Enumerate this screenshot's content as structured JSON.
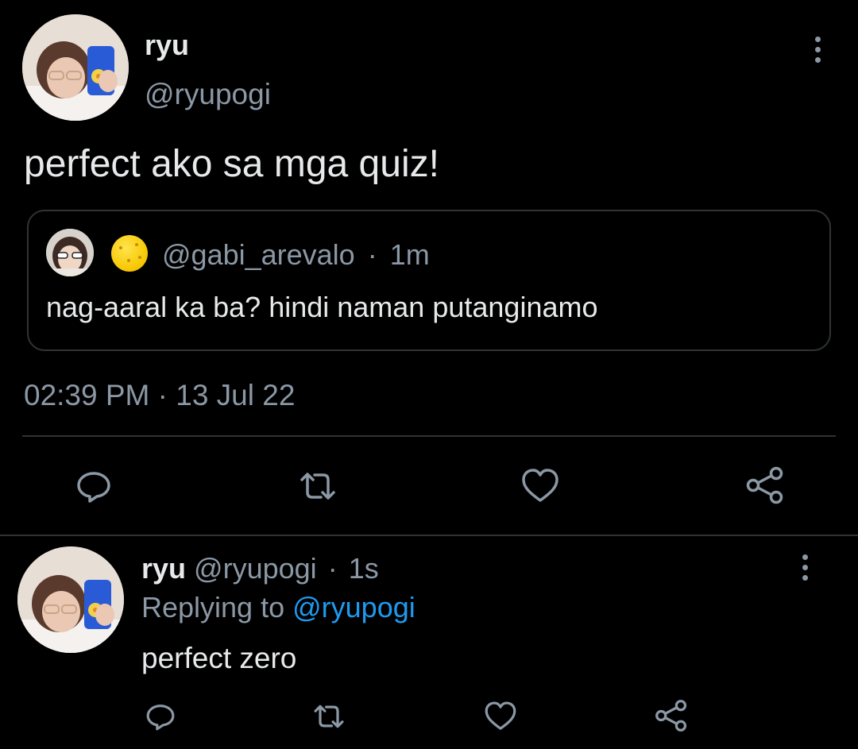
{
  "tweet": {
    "author_name": "ryu",
    "author_handle": "@ryupogi",
    "text": "perfect ako sa mga quiz!",
    "quoted": {
      "handle": "@gabi_arevalo",
      "separator": "·",
      "time_ago": "1m",
      "text": "nag-aaral ka ba? hindi naman putanginamo"
    },
    "timestamp": "02:39 PM · 13 Jul 22",
    "actions": [
      "reply-icon",
      "retweet-icon",
      "like-icon",
      "share-icon"
    ]
  },
  "reply": {
    "author_name": "ryu",
    "author_handle": "@ryupogi",
    "separator": "·",
    "time_ago": "1s",
    "replying_prefix": "Replying to",
    "replying_to": "@ryupogi",
    "text": "perfect zero",
    "actions": [
      "reply-icon",
      "retweet-icon",
      "like-icon",
      "share-icon"
    ]
  },
  "colors": {
    "background": "#000000",
    "primary_text": "#e7e9ea",
    "secondary_text": "#8b98a5",
    "link": "#1d9bf0",
    "border": "#2f3336"
  }
}
